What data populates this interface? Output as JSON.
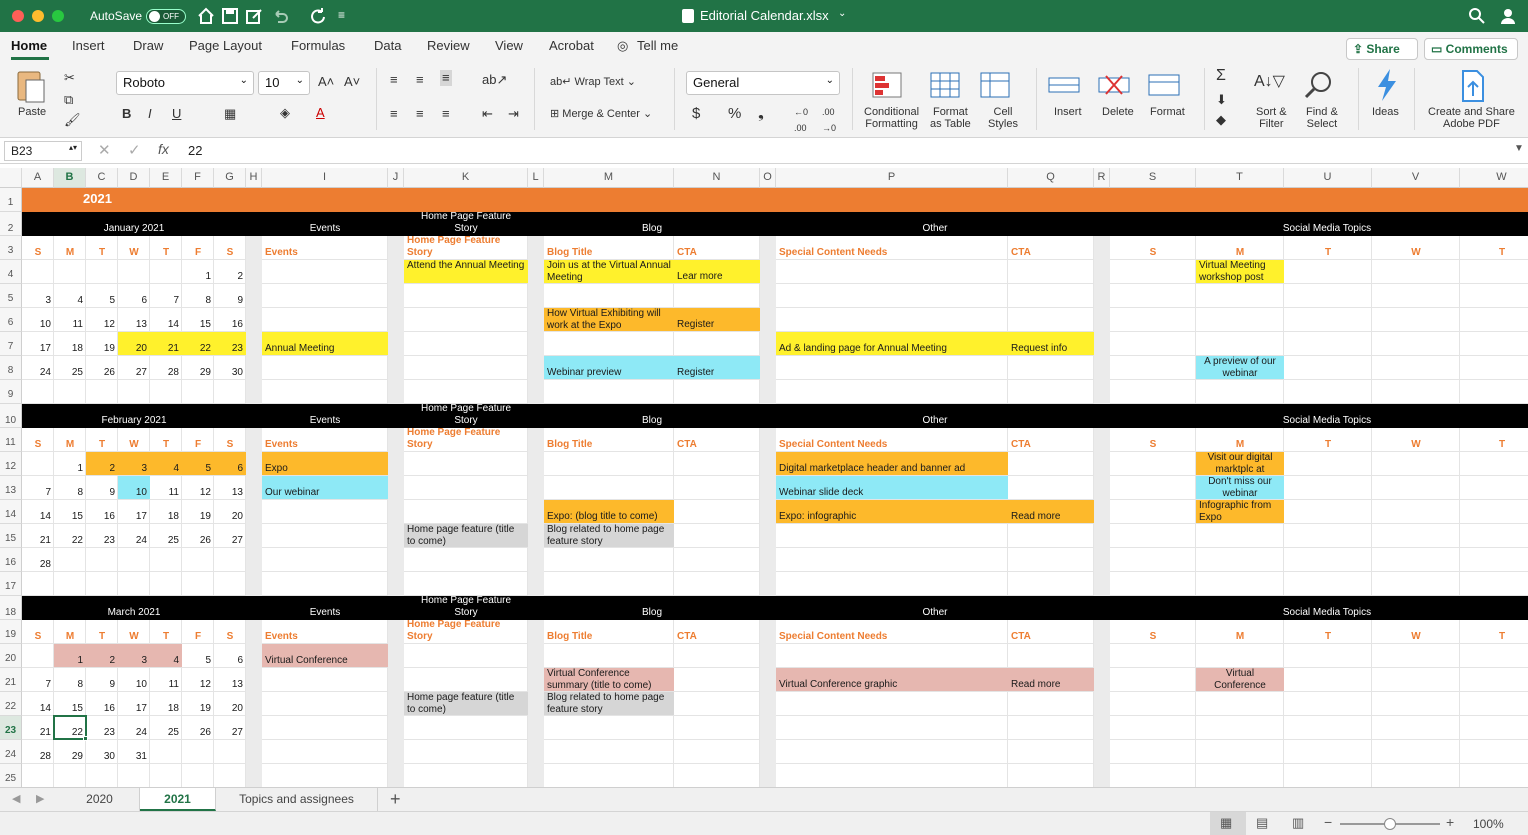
{
  "window": {
    "autosave": "AutoSave",
    "off": "OFF",
    "title": "Editorial Calendar.xlsx"
  },
  "tabs": [
    "Home",
    "Insert",
    "Draw",
    "Page Layout",
    "Formulas",
    "Data",
    "Review",
    "View",
    "Acrobat"
  ],
  "tell_me": "Tell me",
  "share": "Share",
  "comments": "Comments",
  "ribbon": {
    "paste": "Paste",
    "font": "Roboto",
    "size": "10",
    "wrap": "Wrap Text",
    "merge": "Merge & Center",
    "format": "General",
    "cond1": "Conditional",
    "cond2": "Formatting",
    "fmt1": "Format",
    "fmt2": "as Table",
    "cell1": "Cell",
    "cell2": "Styles",
    "insert": "Insert",
    "delete": "Delete",
    "format_btn": "Format",
    "sort1": "Sort &",
    "sort2": "Filter",
    "find1": "Find &",
    "find2": "Select",
    "ideas": "Ideas",
    "pdf1": "Create and Share",
    "pdf2": "Adobe PDF"
  },
  "formula": {
    "cell": "B23",
    "value": "22"
  },
  "columns": [
    "A",
    "B",
    "C",
    "D",
    "E",
    "F",
    "G",
    "H",
    "I",
    "J",
    "K",
    "L",
    "M",
    "N",
    "O",
    "P",
    "Q",
    "R",
    "S",
    "T",
    "U",
    "V",
    "W"
  ],
  "year": "2021",
  "headers": {
    "events": "Events",
    "hp1": "Home Page Feature",
    "hp2": "Story",
    "blog": "Blog",
    "other": "Other",
    "social": "Social Media Topics",
    "blog_title": "Blog Title",
    "cta": "CTA",
    "special": "Special Content Needs"
  },
  "days": [
    "S",
    "M",
    "T",
    "W",
    "T",
    "F",
    "S"
  ],
  "social_days": [
    "S",
    "M",
    "T",
    "W",
    "T"
  ],
  "months": [
    "January 2021",
    "February 2021",
    "March 2021"
  ],
  "jan": [
    [
      "",
      "",
      "",
      "",
      "",
      "1",
      "2"
    ],
    [
      "3",
      "4",
      "5",
      "6",
      "7",
      "8",
      "9"
    ],
    [
      "10",
      "11",
      "12",
      "13",
      "14",
      "15",
      "16"
    ],
    [
      "17",
      "18",
      "19",
      "20",
      "21",
      "22",
      "23"
    ],
    [
      "24",
      "25",
      "26",
      "27",
      "28",
      "29",
      "30"
    ]
  ],
  "feb": [
    [
      "",
      "1",
      "2",
      "3",
      "4",
      "5",
      "6"
    ],
    [
      "7",
      "8",
      "9",
      "10",
      "11",
      "12",
      "13"
    ],
    [
      "14",
      "15",
      "16",
      "17",
      "18",
      "19",
      "20"
    ],
    [
      "21",
      "22",
      "23",
      "24",
      "25",
      "26",
      "27"
    ],
    [
      "28",
      "",
      "",
      "",
      "",
      "",
      ""
    ]
  ],
  "mar": [
    [
      "",
      "1",
      "2",
      "3",
      "4",
      "5",
      "6"
    ],
    [
      "7",
      "8",
      "9",
      "10",
      "11",
      "12",
      "13"
    ],
    [
      "14",
      "15",
      "16",
      "17",
      "18",
      "19",
      "20"
    ],
    [
      "21",
      "22",
      "23",
      "24",
      "25",
      "26",
      "27"
    ],
    [
      "28",
      "29",
      "30",
      "31",
      "",
      "",
      ""
    ]
  ],
  "jan_cells": {
    "hp": "Attend the Annual Meeting",
    "blog1": "Join us at the Virtual Annual Meeting",
    "cta1": "Lear more",
    "blog2": "How Virtual Exhibiting will work at the Expo",
    "cta2": "Register",
    "event": "Annual Meeting",
    "special": "Ad & landing page for Annual Meeting",
    "cta3": "Request info",
    "blog3": "Webinar preview",
    "cta4": "Register",
    "social1": "Virtual Meeting workshop post",
    "social2": "A preview of our webinar"
  },
  "feb_cells": {
    "event1": "Expo",
    "special1": "Digital marketplace header and banner ad",
    "social1": "Visit our digital marktplc at",
    "event2": "Our webinar",
    "special2": "Webinar slide deck",
    "social2": "Don't miss our webinar",
    "blog1": "Expo: (blog title to come)",
    "special3": "Expo: infographic",
    "cta": "Read more",
    "social3": "Infographic from Expo",
    "hp": "Home page feature (title to come)",
    "blog2": "Blog related to home page feature story"
  },
  "mar_cells": {
    "event": "Virtual Conference",
    "blog1": "Virtual Conference summary (title to come)",
    "special": "Virtual Conference graphic",
    "cta": "Read more",
    "social": "Virtual Conference",
    "hp": "Home page feature (title to come)",
    "blog2": "Blog related to home page feature story"
  },
  "sheets": [
    "2020",
    "2021",
    "Topics and assignees"
  ],
  "zoom": "100%",
  "colors": {
    "excel": "#217346",
    "orange": "#ed7d31",
    "yellow": "#fff12c",
    "gold": "#fdb92b",
    "cyan": "#8ee9f6",
    "pink": "#e6b7b0",
    "gray": "#d6d6d6",
    "hdrtext": "#ed7d31"
  }
}
